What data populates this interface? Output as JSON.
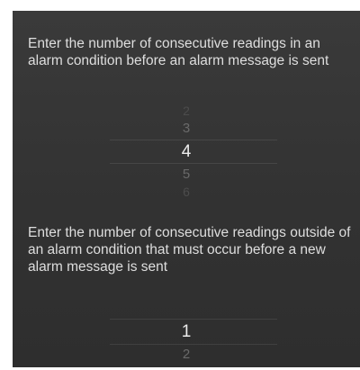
{
  "readings_in_alarm": {
    "instruction": "Enter the number of consecutive readings in an alarm condition before an alarm message is sent",
    "options": [
      "2",
      "3",
      "4",
      "5",
      "6"
    ],
    "selected": "4"
  },
  "readings_outside_alarm": {
    "instruction": "Enter the number of consecutive readings outside of an alarm condition that must occur before a new alarm message is sent",
    "options": [
      "1",
      "2"
    ],
    "selected": "1"
  }
}
